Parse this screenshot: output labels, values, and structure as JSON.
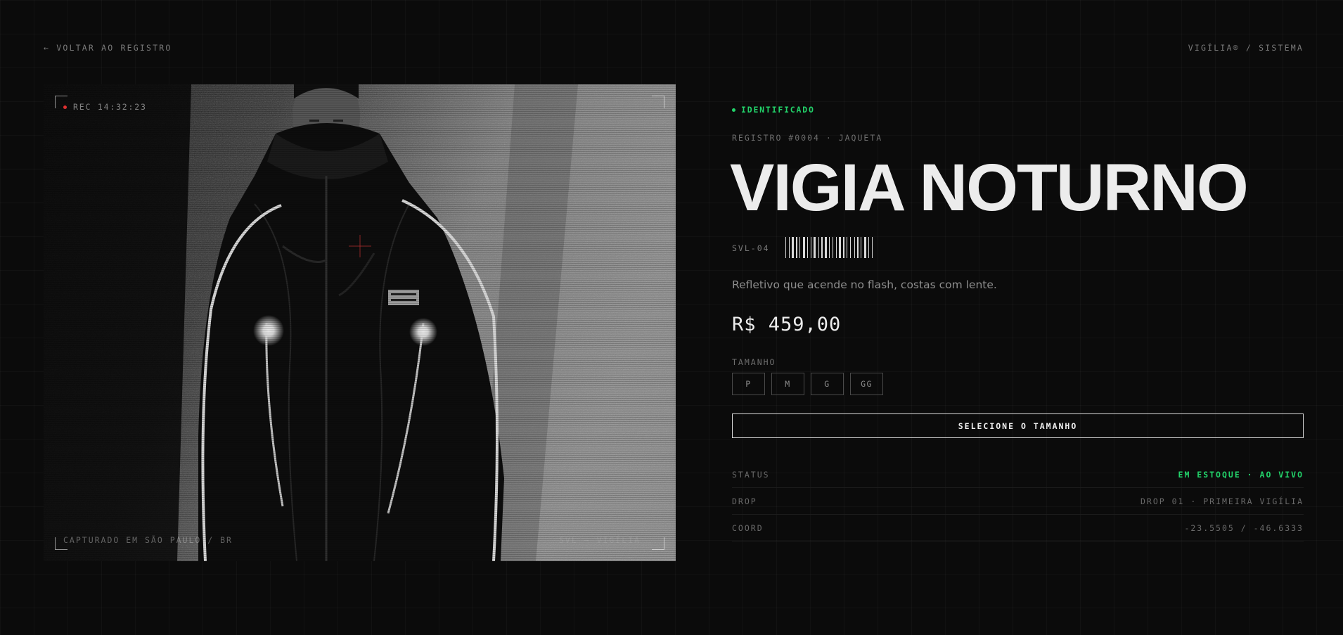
{
  "nav": {
    "back_label": "← VOLTAR AO REGISTRO",
    "system_label": "VIGÍLIA® / SISTEMA"
  },
  "photo": {
    "rec_label": "REC 14:32:23",
    "caption_left": "CAPTURADO EM SÃO PAULO / BR",
    "caption_right": "SVL — VIGÍLIA"
  },
  "product": {
    "status": "IDENTIFICADO",
    "registro": "REGISTRO #0004 · JAQUETA",
    "title": "VIGIA NOTURNO",
    "sku": "SVL-04",
    "description": "Refletivo que acende no flash, costas com lente.",
    "price": "R$ 459,00",
    "size_label": "TAMANHO",
    "sizes": [
      "P",
      "M",
      "G",
      "GG"
    ],
    "cta_label": "SELECIONE O TAMANHO"
  },
  "specs": [
    {
      "key": "STATUS",
      "value": "EM ESTOQUE · AO VIVO"
    },
    {
      "key": "DROP",
      "value": "DROP 01 · PRIMEIRA VIGÍLIA"
    },
    {
      "key": "COORD",
      "value": "-23.5505 / -46.6333"
    }
  ],
  "colors": {
    "background": "#0b0b0b",
    "accent_live": "#22d36a",
    "rec_dot": "#e03131",
    "text": "#e6e6e6"
  },
  "icons": [
    "arrow-left-icon",
    "status-dot-icon",
    "rec-dot-icon",
    "crosshair-icon",
    "barcode-icon"
  ]
}
